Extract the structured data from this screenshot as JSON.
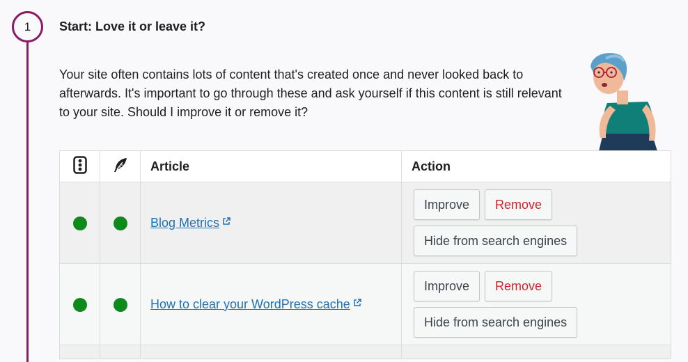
{
  "step": {
    "number": "1",
    "title": "Start: Love it or leave it?",
    "intro": "Your site often contains lots of content that's created once and never looked back to afterwards. It's important to go through these and ask yourself if this content is still relevant to your site. Should I improve it or remove it?"
  },
  "colors": {
    "accent": "#8a1c63",
    "status_good": "#0d8a1a",
    "link": "#2271b1",
    "remove": "#c9252c"
  },
  "table": {
    "columns": {
      "seo_icon": "traffic-light-icon",
      "readability_icon": "feather-icon",
      "article": "Article",
      "action": "Action"
    },
    "rows": [
      {
        "article": "Blog Metrics",
        "seo_status": "good",
        "readability_status": "good",
        "actions": {
          "improve": "Improve",
          "remove": "Remove",
          "hide": "Hide from search engines"
        }
      },
      {
        "article": "How to clear your WordPress cache",
        "seo_status": "good",
        "readability_status": "good",
        "actions": {
          "improve": "Improve",
          "remove": "Remove",
          "hide": "Hide from search engines"
        }
      }
    ]
  }
}
